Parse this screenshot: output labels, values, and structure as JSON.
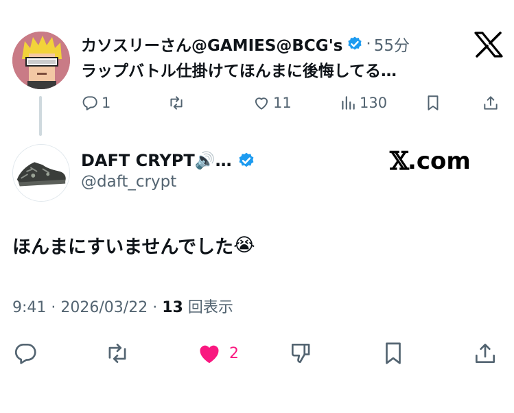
{
  "parent_tweet": {
    "display_name": "カソスリーさん@GAMIES@BCG's",
    "time_separator": "·",
    "time": "55分",
    "text": "ラップバトル仕掛けてほんまに後悔してる…",
    "actions": {
      "reply_count": "1",
      "retweet_count": "",
      "like_count": "11",
      "view_count": "130"
    }
  },
  "main_tweet": {
    "display_name": "DAFT CRYPT🔊…",
    "handle": "@daft_crypt",
    "brand": {
      "mark": "𝕏",
      "suffix": ".com"
    },
    "text": "ほんまにすいませんでした",
    "emoji": "😭",
    "meta": {
      "time": "9:41",
      "separator": "·",
      "date": "2026/03/22",
      "views_count": "13",
      "views_label": "回表示"
    },
    "actions": {
      "like_count": "2"
    }
  },
  "colors": {
    "verified": "#1d9bf0",
    "like_active": "#f91880",
    "secondary_text": "#536471",
    "thread_line": "#cfd9de"
  }
}
